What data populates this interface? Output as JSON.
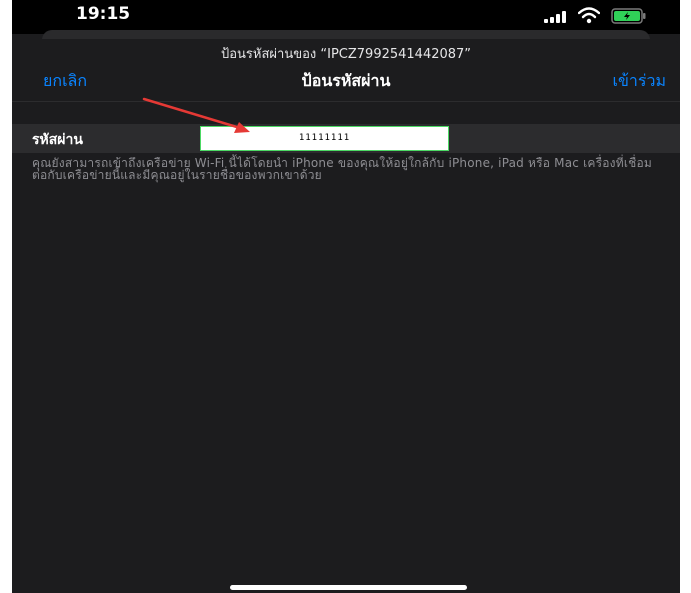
{
  "status_bar": {
    "time": "19:15"
  },
  "sheet": {
    "prompt": "ป้อนรหัสผ่านของ “IPCZ7992541442087”",
    "cancel_label": "ยกเลิก",
    "title": "ป้อนรหัสผ่าน",
    "join_label": "เข้าร่วม"
  },
  "password": {
    "label": "รหัสผ่าน",
    "value": "11111111"
  },
  "info_text": "คุณยังสามารถเข้าถึงเครือข่าย Wi-Fi นี้ได้โดยนำ iPhone ของคุณให้อยู่ใกล้กับ iPhone, iPad หรือ Mac เครื่องที่เชื่อมต่อกับเครือข่ายนี้และมีคุณอยู่ในรายชื่อของพวกเขาด้วย",
  "colors": {
    "accent": "#0a84ff",
    "input_border": "#4cd964",
    "arrow": "#e53935",
    "background": "#1c1c1e"
  },
  "icons": [
    "signal-icon",
    "wifi-icon",
    "battery-icon",
    "annotation-arrow-icon"
  ]
}
